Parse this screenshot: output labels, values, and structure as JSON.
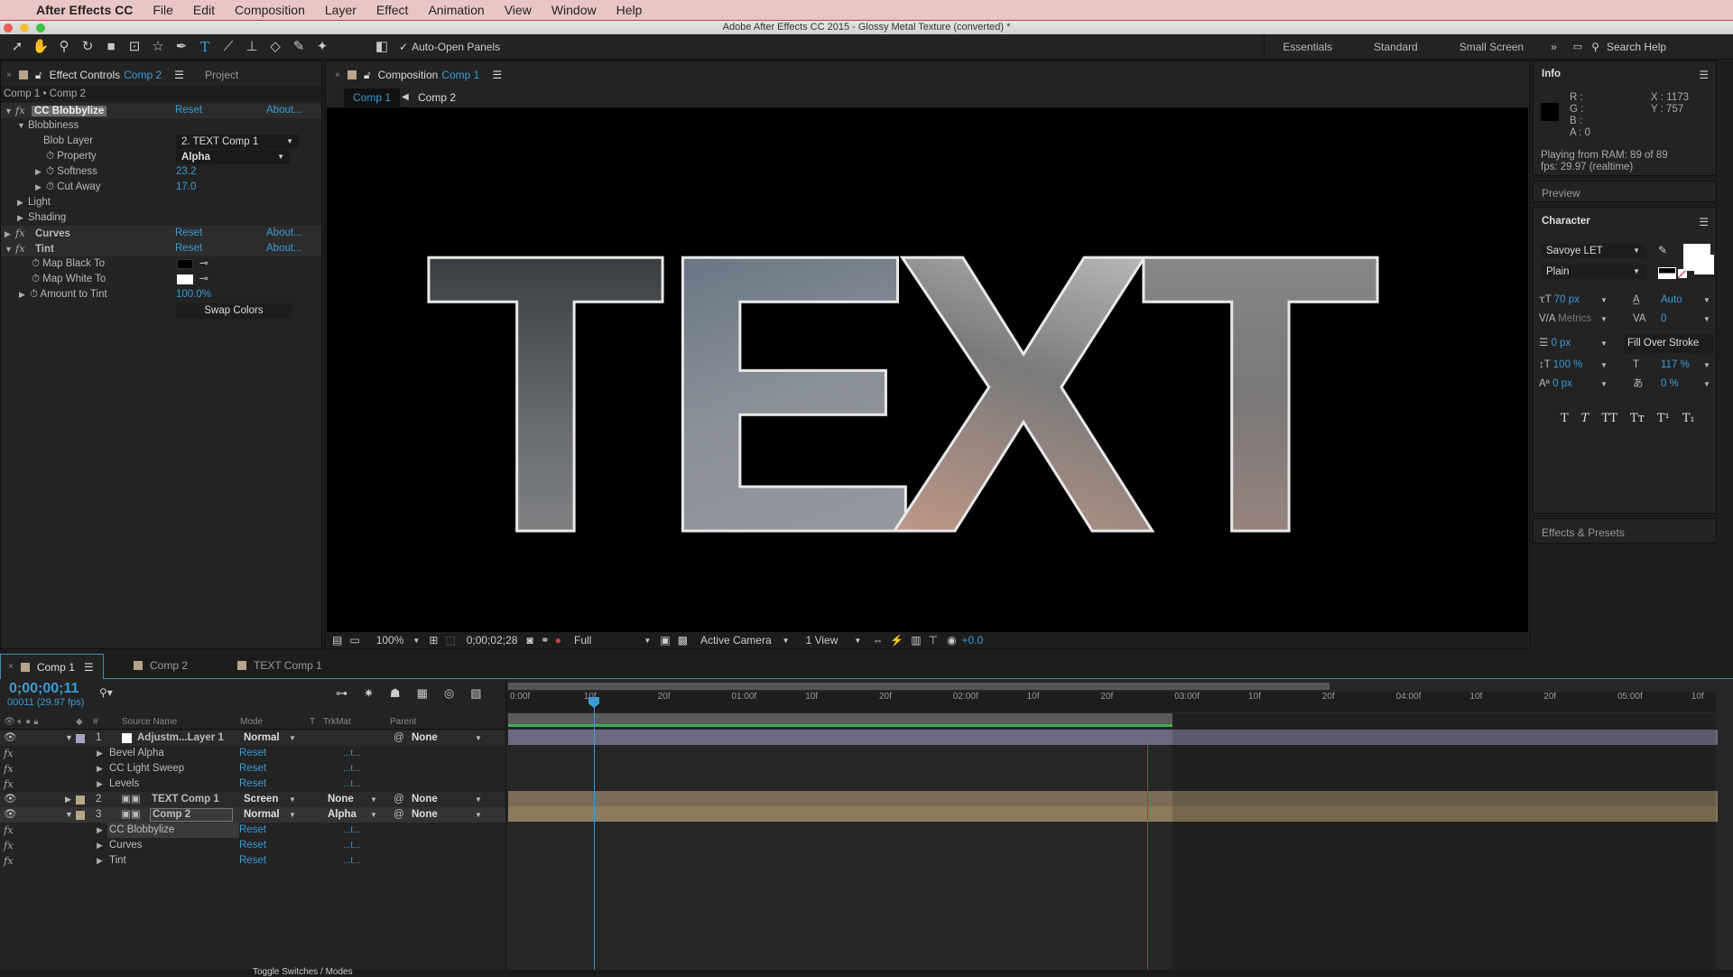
{
  "menubar": {
    "app": "After Effects CC",
    "items": [
      "File",
      "Edit",
      "Composition",
      "Layer",
      "Effect",
      "Animation",
      "View",
      "Window",
      "Help"
    ]
  },
  "window_title": "Adobe After Effects CC 2015 - Glossy Metal Texture (converted) *",
  "toolbar": {
    "tools": [
      "selection-tool",
      "hand-tool",
      "zoom-tool",
      "rotate-tool",
      "camera-tool",
      "pan-behind-tool",
      "shape-tool",
      "pen-tool",
      "type-tool",
      "brush-tool",
      "clone-stamp-tool",
      "eraser-tool",
      "roto-brush-tool",
      "puppet-tool"
    ],
    "auto_open_label": "Auto-Open Panels",
    "workspaces": [
      "Essentials",
      "Standard",
      "Small Screen"
    ],
    "overflow": "»",
    "search_placeholder": "Search Help"
  },
  "effect_controls": {
    "tab_label": "Effect Controls",
    "tab_comp": "Comp 2",
    "project_tab": "Project",
    "breadcrumb": "Comp 1 • Comp 2",
    "rows": [
      {
        "name": "CC Blobbylize",
        "reset": "Reset",
        "about": "About..."
      },
      {
        "name": "Blobbiness"
      },
      {
        "name": "Blob Layer",
        "value": "2. TEXT Comp 1"
      },
      {
        "name": "Property",
        "value": "Alpha"
      },
      {
        "name": "Softness",
        "value": "23.2"
      },
      {
        "name": "Cut Away",
        "value": "17.0"
      },
      {
        "name": "Light"
      },
      {
        "name": "Shading"
      },
      {
        "name": "Curves",
        "reset": "Reset",
        "about": "About..."
      },
      {
        "name": "Tint",
        "reset": "Reset",
        "about": "About..."
      },
      {
        "name": "Map Black To",
        "color": "#000000"
      },
      {
        "name": "Map White To",
        "color": "#ffffff"
      },
      {
        "name": "Amount to Tint",
        "value": "100.0%"
      },
      {
        "name": "Swap Colors"
      }
    ]
  },
  "composition": {
    "tab_label": "Composition",
    "tab_comp": "Comp 1",
    "crumbs": [
      "Comp 1",
      "Comp 2"
    ],
    "viewer_text": [
      "T",
      "E",
      "X",
      "T"
    ],
    "bar": {
      "zoom": "100%",
      "timecode": "0;00;02;28",
      "resolution": "Full",
      "camera": "Active Camera",
      "views": "1 View",
      "exposure": "+0.0"
    }
  },
  "info": {
    "title": "Info",
    "r": "R :",
    "g": "G :",
    "b": "B :",
    "a": "A : 0",
    "x": "X : 1173",
    "y": "Y : 757",
    "status1": "Playing from RAM: 89 of 89",
    "status2": "fps: 29.97 (realtime)"
  },
  "preview": {
    "title": "Preview"
  },
  "character": {
    "title": "Character",
    "font": "Savoye LET",
    "style": "Plain",
    "size": "70 px",
    "leading": "Auto",
    "kerning": "Metrics",
    "tracking": "0",
    "stroke": "0 px",
    "stroke_mode": "Fill Over Stroke",
    "vscale": "100 %",
    "hscale": "117 %",
    "baseline": "0 px",
    "tsume": "0 %",
    "styles": [
      "T",
      "T",
      "TT",
      "Tт",
      "T¹",
      "T₁"
    ]
  },
  "effects_presets": {
    "title": "Effects & Presets"
  },
  "timeline": {
    "tabs": [
      "Comp 1",
      "Comp 2",
      "TEXT Comp 1"
    ],
    "timecode": "0;00;00;11",
    "frame_info": "00011 (29.97 fps)",
    "headers": {
      "num": "#",
      "source": "Source Name",
      "mode": "Mode",
      "t": "T",
      "trkmat": "TrkMat",
      "parent": "Parent"
    },
    "ruler": [
      "0:00f",
      "10f",
      "20f",
      "01:00f",
      "10f",
      "20f",
      "02:00f",
      "10f",
      "20f",
      "03:00f",
      "10f",
      "20f",
      "04:00f",
      "10f",
      "20f",
      "05:00f",
      "10f"
    ],
    "layers": [
      {
        "num": "1",
        "name": "Adjustm...Layer 1",
        "mode": "Normal",
        "trkmat": "",
        "parent": "None",
        "fx": [
          {
            "name": "Bevel Alpha",
            "reset": "Reset"
          },
          {
            "name": "CC Light Sweep",
            "reset": "Reset"
          },
          {
            "name": "Levels",
            "reset": "Reset"
          }
        ]
      },
      {
        "num": "2",
        "name": "TEXT Comp 1",
        "mode": "Screen",
        "trkmat": "None",
        "parent": "None",
        "fx": []
      },
      {
        "num": "3",
        "name": "Comp 2",
        "mode": "Normal",
        "trkmat": "Alpha",
        "parent": "None",
        "fx": [
          {
            "name": "CC Blobbylize",
            "reset": "Reset"
          },
          {
            "name": "Curves",
            "reset": "Reset"
          },
          {
            "name": "Tint",
            "reset": "Reset"
          }
        ]
      }
    ],
    "keyframe_marker": "...t...",
    "footer": "Toggle Switches / Modes"
  }
}
